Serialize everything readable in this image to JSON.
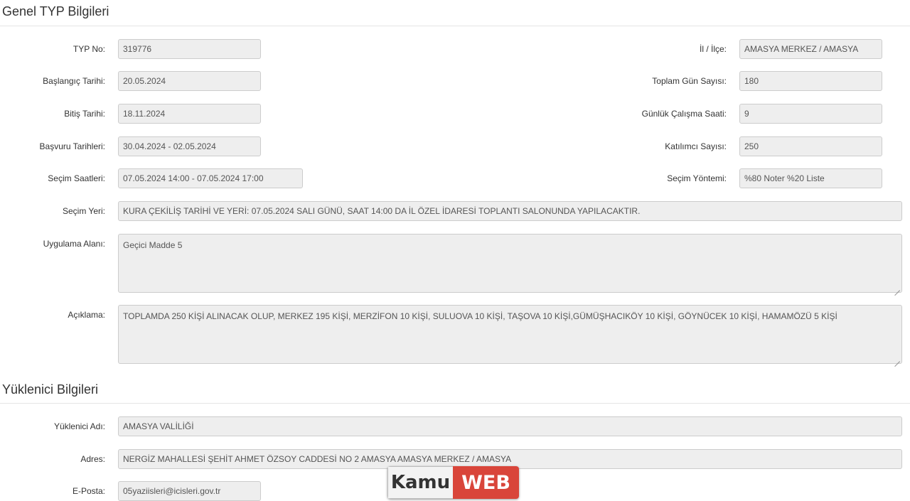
{
  "general": {
    "title": "Genel TYP Bilgileri",
    "typ_no": {
      "label": "TYP No:",
      "value": "319776"
    },
    "il_ilce": {
      "label": "İl / İlçe:",
      "value": "AMASYA MERKEZ / AMASYA"
    },
    "baslangic": {
      "label": "Başlangıç Tarihi:",
      "value": "20.05.2024"
    },
    "toplam_gun": {
      "label": "Toplam Gün Sayısı:",
      "value": "180"
    },
    "bitis": {
      "label": "Bitiş Tarihi:",
      "value": "18.11.2024"
    },
    "gunluk_saat": {
      "label": "Günlük Çalışma Saati:",
      "value": "9"
    },
    "basvuru": {
      "label": "Başvuru Tarihleri:",
      "value": "30.04.2024 - 02.05.2024"
    },
    "katilimci": {
      "label": "Katılımcı Sayısı:",
      "value": "250"
    },
    "secim_saatleri": {
      "label": "Seçim Saatleri:",
      "value": "07.05.2024 14:00 - 07.05.2024 17:00"
    },
    "secim_yontemi": {
      "label": "Seçim Yöntemi:",
      "value": "%80 Noter %20 Liste"
    },
    "secim_yeri": {
      "label": "Seçim Yeri:",
      "value": "KURA ÇEKİLİŞ TARİHİ VE YERİ: 07.05.2024 SALI  GÜNÜ, SAAT 14:00 DA  İL ÖZEL İDARESİ TOPLANTI SALONUNDA YAPILACAKTIR."
    },
    "uygulama_alani": {
      "label": "Uygulama Alanı:",
      "value": "Geçici Madde 5"
    },
    "aciklama": {
      "label": "Açıklama:",
      "value": "TOPLAMDA 250 KİŞİ ALINACAK OLUP, MERKEZ 195 KİŞİ, MERZİFON 10 KİŞİ, SULUOVA 10 KİŞİ, TAŞOVA 10 KİŞİ,GÜMÜŞHACIKÖY 10 KİŞİ, GÖYNÜCEK 10 KİŞİ, HAMAMÖZÜ 5 KİŞİ"
    }
  },
  "contractor": {
    "title": "Yüklenici Bilgileri",
    "adi": {
      "label": "Yüklenici Adı:",
      "value": "AMASYA VALİLİĞİ"
    },
    "adres": {
      "label": "Adres:",
      "value": "NERGİZ MAHALLESİ ŞEHİT AHMET ÖZSOY CADDESİ NO 2 AMASYA AMASYA MERKEZ / AMASYA"
    },
    "eposta": {
      "label": "E-Posta:",
      "value": "05yaziisleri@icisleri.gov.tr"
    }
  },
  "watermark": {
    "part1": "Kamu",
    "part2": "WEB",
    "accent": "#d9453a"
  }
}
